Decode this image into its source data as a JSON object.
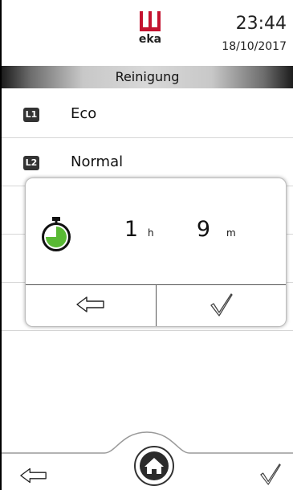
{
  "header": {
    "brand": "eka",
    "time": "23:44",
    "date": "18/10/2017"
  },
  "titlebar": {
    "title": "Reinigung"
  },
  "programs": [
    {
      "badge": "L1",
      "label": "Eco"
    },
    {
      "badge": "L2",
      "label": "Normal"
    }
  ],
  "timer_dialog": {
    "hours": "1",
    "hours_unit": "h",
    "minutes": "9",
    "minutes_unit": "m",
    "timer_icon": "stopwatch-icon",
    "back_icon": "arrow-left-icon",
    "confirm_icon": "checkmark-icon"
  },
  "bottom_nav": {
    "back_icon": "arrow-left-icon",
    "home_icon": "home-icon",
    "confirm_icon": "checkmark-icon"
  },
  "colors": {
    "brand_red": "#c4122f",
    "timer_green": "#59b934",
    "text": "#111111"
  }
}
